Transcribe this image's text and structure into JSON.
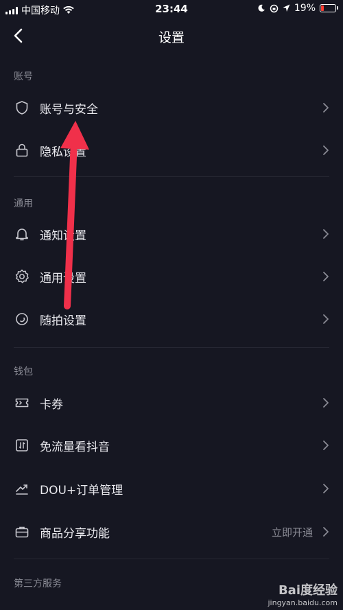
{
  "status_bar": {
    "carrier": "中国移动",
    "time": "23:44",
    "battery": "19%",
    "battery_level": 0.19,
    "battery_color": "#ff3b30"
  },
  "nav": {
    "title": "设置",
    "back_icon": "chevron-left-icon"
  },
  "sections": [
    {
      "header": "账号",
      "items": [
        {
          "label": "账号与安全",
          "icon": "shield-icon"
        },
        {
          "label": "隐私设置",
          "icon": "lock-icon"
        }
      ]
    },
    {
      "header": "通用",
      "items": [
        {
          "label": "通知设置",
          "icon": "bell-icon"
        },
        {
          "label": "通用设置",
          "icon": "gear-icon"
        },
        {
          "label": "随拍设置",
          "icon": "capture-icon"
        }
      ]
    },
    {
      "header": "钱包",
      "items": [
        {
          "label": "卡券",
          "icon": "ticket-icon"
        },
        {
          "label": "免流量看抖音",
          "icon": "data-free-icon"
        },
        {
          "label": "DOU+订单管理",
          "icon": "trend-icon"
        },
        {
          "label": "商品分享功能",
          "icon": "shop-icon",
          "value": "立即开通"
        }
      ]
    },
    {
      "header": "第三方服务",
      "items": []
    }
  ],
  "watermark": {
    "brand": "Bai度经验",
    "url": "jingyan.baidu.com"
  },
  "colors": {
    "background": "#161722",
    "annotation_arrow": "#f0304a"
  }
}
